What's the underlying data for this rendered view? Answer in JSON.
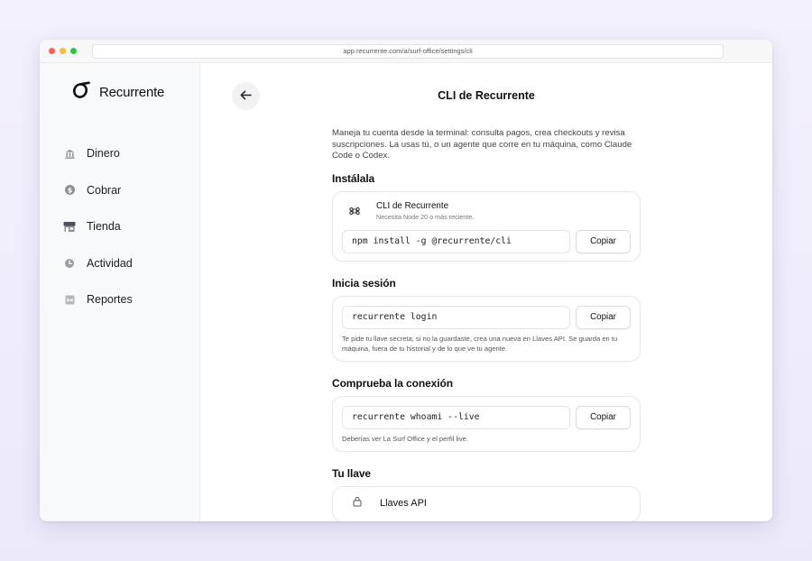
{
  "browser": {
    "url": "app.recurrente.com/a/surf-office/settings/cli"
  },
  "brand": {
    "name": "Recurrente",
    "color": "#111111"
  },
  "sidebar": {
    "items": [
      {
        "label": "Dinero",
        "icon": "bank-icon"
      },
      {
        "label": "Cobrar",
        "icon": "dollar-coin-icon"
      },
      {
        "label": "Tienda",
        "icon": "storefront-icon"
      },
      {
        "label": "Actividad",
        "icon": "clock-icon"
      },
      {
        "label": "Reportes",
        "icon": "report-icon"
      }
    ]
  },
  "header": {
    "title": "CLI de Recurrente",
    "back_icon": "arrow-left-icon"
  },
  "intro": "Maneja tu cuenta desde la terminal: consulta pagos, crea checkouts y revisa suscripciones. La usas tú, o un agente que corre en tu máquina, como Claude Code o Codex.",
  "install": {
    "title": "Instálala",
    "tool_name": "CLI de Recurrente",
    "tool_requirement": "Necesita Node 20 o más reciente.",
    "tool_icon": "command-icon",
    "command": "npm install -g @recurrente/cli",
    "copy_label": "Copiar"
  },
  "login": {
    "title": "Inicia sesión",
    "command": "recurrente login",
    "copy_label": "Copiar",
    "note": "Te pide tu llave secreta; si no la guardaste, crea una nueva en Llaves API. Se guarda en tu máquina, fuera de tu historial y de lo que ve tu agente."
  },
  "check": {
    "title": "Comprueba la conexión",
    "command": "recurrente whoami --live",
    "copy_label": "Copiar",
    "note": "Deberías ver La Surf Office y el perfil live."
  },
  "key": {
    "title": "Tu llave",
    "item_label": "Llaves API",
    "item_icon": "key-icon"
  }
}
